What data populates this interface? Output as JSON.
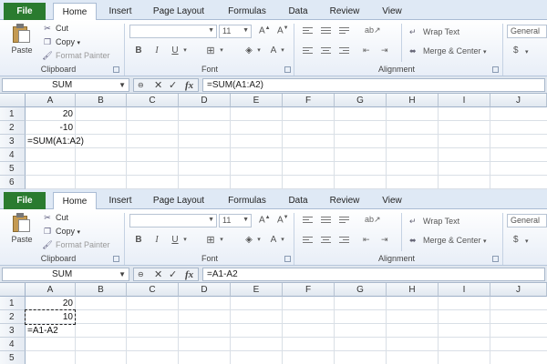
{
  "panes": [
    {
      "tabs": [
        "Home",
        "Insert",
        "Page Layout",
        "Formulas",
        "Data",
        "Review",
        "View"
      ],
      "file_tab": "File",
      "clipboard": {
        "paste": "Paste",
        "cut": "Cut",
        "copy": "Copy",
        "format_painter": "Format Painter",
        "label": "Clipboard"
      },
      "font": {
        "size": "11",
        "label": "Font"
      },
      "alignment": {
        "wrap_text": "Wrap Text",
        "merge_center": "Merge & Center",
        "label": "Alignment"
      },
      "number": {
        "format": "General",
        "currency": "$"
      },
      "name_box": "SUM",
      "formula": "=SUM(A1:A2)",
      "columns": [
        "A",
        "B",
        "C",
        "D",
        "E",
        "F",
        "G",
        "H",
        "I",
        "J"
      ],
      "rows": [
        "1",
        "2",
        "3",
        "4",
        "5",
        "6"
      ],
      "cells": {
        "a1": "20",
        "a2": "-10",
        "a3": "=SUM(A1:A2)"
      },
      "marquee": false
    },
    {
      "tabs": [
        "Home",
        "Insert",
        "Page Layout",
        "Formulas",
        "Data",
        "Review",
        "View"
      ],
      "file_tab": "File",
      "clipboard": {
        "paste": "Paste",
        "cut": "Cut",
        "copy": "Copy",
        "format_painter": "Format Painter",
        "label": "Clipboard"
      },
      "font": {
        "size": "11",
        "label": "Font"
      },
      "alignment": {
        "wrap_text": "Wrap Text",
        "merge_center": "Merge & Center",
        "label": "Alignment"
      },
      "number": {
        "format": "General",
        "currency": "$"
      },
      "name_box": "SUM",
      "formula": "=A1-A2",
      "columns": [
        "A",
        "B",
        "C",
        "D",
        "E",
        "F",
        "G",
        "H",
        "I",
        "J"
      ],
      "rows": [
        "1",
        "2",
        "3",
        "4",
        "5"
      ],
      "cells": {
        "a1": "20",
        "a2": "10",
        "a3": "=A1-A2"
      },
      "marquee": true
    }
  ],
  "colors": {
    "file_tab": "#2a7b2f",
    "ribbon_tabs_bg": "#dfe9f5"
  }
}
